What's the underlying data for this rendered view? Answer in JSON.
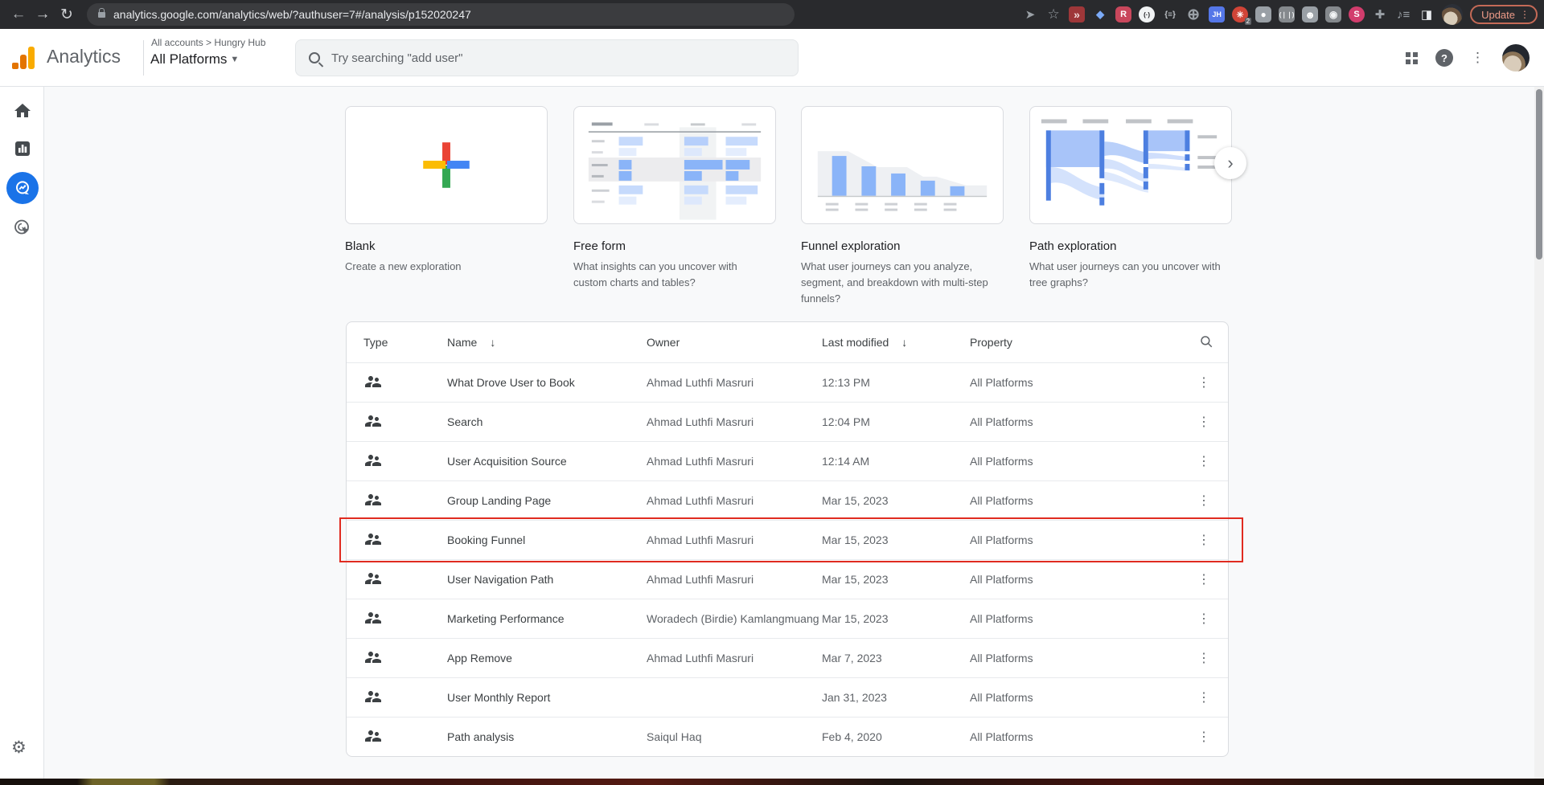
{
  "browser": {
    "url": "analytics.google.com/analytics/web/?authuser=7#/analysis/p152020247",
    "update_label": "Update",
    "extension_icons": [
      {
        "name": "video-speed-extension-icon",
        "glyph": "»",
        "bg": "#9e3739",
        "fg": "#f3dcdc",
        "radius": "4px",
        "fs": 14
      },
      {
        "name": "eyedropper-extension-icon",
        "glyph": "◆",
        "bg": "transparent",
        "fg": "#7baaf7",
        "radius": "2px",
        "fs": 13
      },
      {
        "name": "ribbon-r-extension-icon",
        "glyph": "R",
        "bg": "#c9475c",
        "fg": "#ffffff",
        "radius": "6px",
        "fs": 11
      },
      {
        "name": "parens-dots-extension-icon",
        "glyph": "(·)",
        "bg": "#f1f3f4",
        "fg": "#202124",
        "radius": "50%",
        "fs": 8
      },
      {
        "name": "braces-list-extension-icon",
        "glyph": "{≡}",
        "bg": "transparent",
        "fg": "#bdc1c6",
        "fs": 10
      },
      {
        "name": "globe-extension-icon",
        "glyph": "⊕",
        "bg": "transparent",
        "fg": "#9aa0a6",
        "fs": 19
      },
      {
        "name": "jh-extension-icon",
        "glyph": "JH",
        "bg": "#5577e8",
        "fg": "#ffffff",
        "radius": "4px",
        "fs": 9
      },
      {
        "name": "hand-blocker-extension-icon",
        "glyph": "✳",
        "bg": "#d04437",
        "fg": "#ffffff",
        "radius": "50%",
        "fs": 11,
        "badge": "2"
      },
      {
        "name": "line-messenger-extension-icon",
        "glyph": "●",
        "bg": "#9aa0a6",
        "fg": "#ffffff",
        "radius": "5px",
        "fs": 12
      },
      {
        "name": "stream-bars-extension-icon",
        "glyph": "(❘❘)",
        "bg": "#85898d",
        "fg": "#f1f3f4",
        "radius": "5px",
        "fs": 8
      },
      {
        "name": "person-extension-icon",
        "glyph": "☻",
        "bg": "#9aa0a6",
        "fg": "#ffffff",
        "radius": "5px",
        "fs": 13
      },
      {
        "name": "camera-extension-icon",
        "glyph": "◉",
        "bg": "#85898d",
        "fg": "#f1f3f4",
        "radius": "5px",
        "fs": 12
      },
      {
        "name": "s-ribbon-extension-icon",
        "glyph": "S",
        "bg": "#d23d6d",
        "fg": "#ffffff",
        "radius": "50%",
        "fs": 11
      }
    ]
  },
  "header": {
    "product": "Analytics",
    "accounts_breadcrumb": "All accounts > Hungry Hub",
    "property": "All Platforms",
    "search_placeholder": "Try searching \"add user\""
  },
  "sidebar": {
    "selected": "explore"
  },
  "templates": {
    "cards": [
      {
        "title": "Blank",
        "description": "Create a new exploration"
      },
      {
        "title": "Free form",
        "description": "What insights can you uncover with custom charts and tables?"
      },
      {
        "title": "Funnel exploration",
        "description": "What user journeys can you analyze, segment, and breakdown with multi-step funnels?"
      },
      {
        "title": "Path exploration",
        "description": "What user journeys can you uncover with tree graphs?"
      }
    ]
  },
  "table": {
    "headers": {
      "type": "Type",
      "name": "Name",
      "owner": "Owner",
      "modified": "Last modified",
      "property": "Property"
    },
    "rows": [
      {
        "name": "What Drove User to Book",
        "owner": "Ahmad Luthfi Masruri",
        "modified": "12:13 PM",
        "property": "All Platforms"
      },
      {
        "name": "Search",
        "owner": "Ahmad Luthfi Masruri",
        "modified": "12:04 PM",
        "property": "All Platforms"
      },
      {
        "name": "User Acquisition Source",
        "owner": "Ahmad Luthfi Masruri",
        "modified": "12:14 AM",
        "property": "All Platforms"
      },
      {
        "name": "Group Landing Page",
        "owner": "Ahmad Luthfi Masruri",
        "modified": "Mar 15, 2023",
        "property": "All Platforms"
      },
      {
        "name": "Booking Funnel",
        "owner": "Ahmad Luthfi Masruri",
        "modified": "Mar 15, 2023",
        "property": "All Platforms",
        "highlighted": true
      },
      {
        "name": "User Navigation Path",
        "owner": "Ahmad Luthfi Masruri",
        "modified": "Mar 15, 2023",
        "property": "All Platforms"
      },
      {
        "name": "Marketing Performance",
        "owner": "Woradech (Birdie) Kamlangmuang",
        "modified": "Mar 15, 2023",
        "property": "All Platforms"
      },
      {
        "name": "App Remove",
        "owner": "Ahmad Luthfi Masruri",
        "modified": "Mar 7, 2023",
        "property": "All Platforms"
      },
      {
        "name": "User Monthly Report",
        "owner": "",
        "modified": "Jan 31, 2023",
        "property": "All Platforms"
      },
      {
        "name": "Path analysis",
        "owner": "Saiqul Haq",
        "modified": "Feb 4, 2020",
        "property": "All Platforms"
      }
    ]
  },
  "colors": {
    "accent_blue": "#1a73e8",
    "highlight_red": "#e02b20",
    "update_orange": "#ed9b88"
  }
}
